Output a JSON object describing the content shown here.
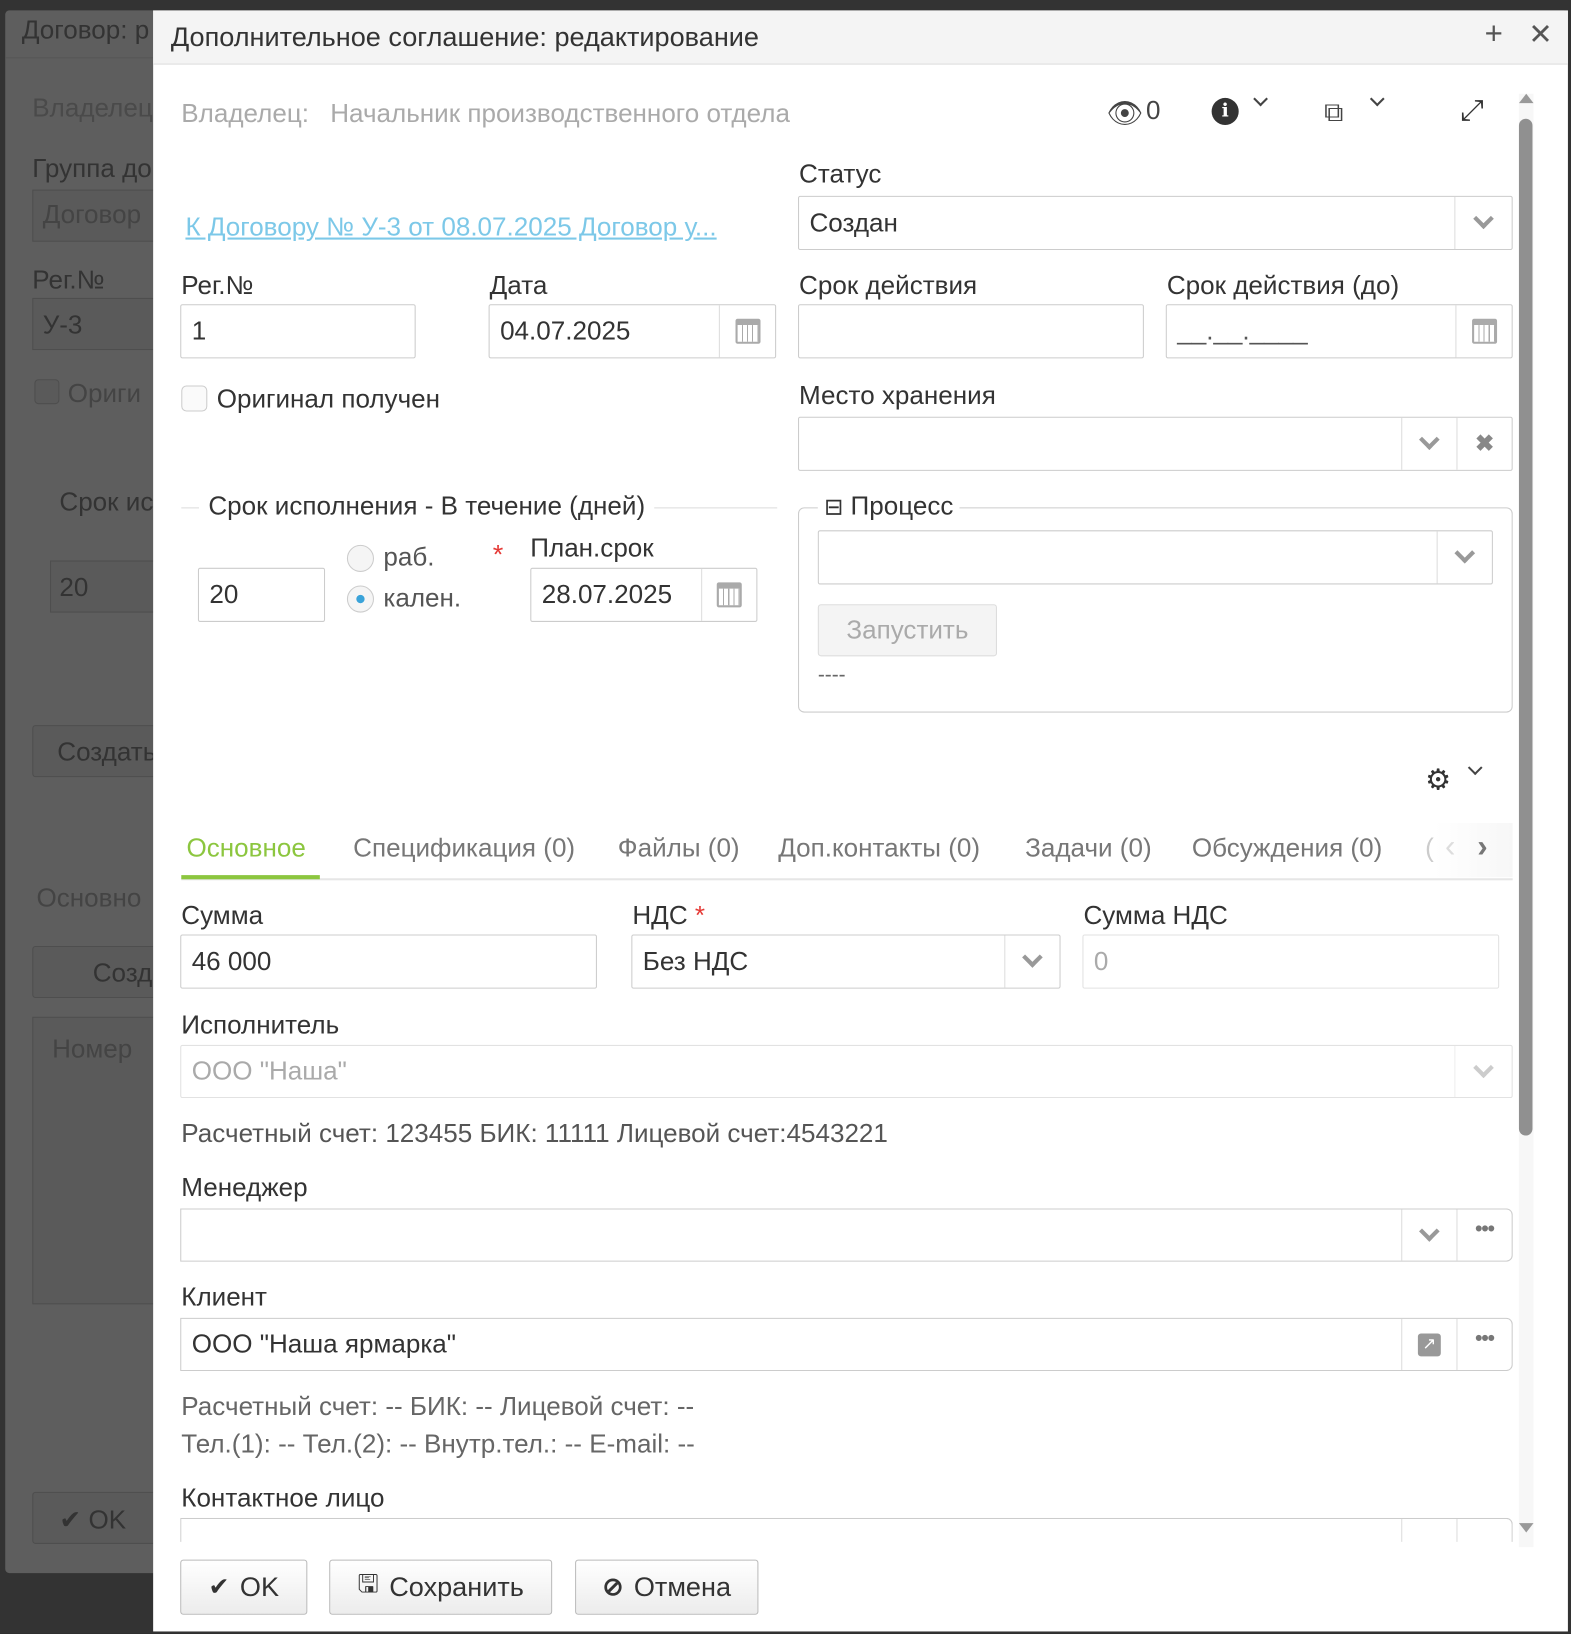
{
  "background": {
    "title": "Договор: р",
    "owner": "Владелец",
    "group_label": "Группа до",
    "group_value": "Договор",
    "reg_label": "Рег.№",
    "reg_value": "У-3",
    "original": "Ориги",
    "term": "Срок ис",
    "days": "20",
    "create": "Создать",
    "tab": "Основно",
    "create_doc": "Созд",
    "number_col": "Номер",
    "ok": "OK"
  },
  "modal": {
    "title": "Дополнительное соглашение: редактирование",
    "owner_label": "Владелец:",
    "owner_value": "Начальник производственного отдела",
    "views_count": "0",
    "link": "К Договору № У-3 от 08.07.2025 Договор у...",
    "status_label": "Статус",
    "status_value": "Создан",
    "reg_label": "Рег.№",
    "reg_value": "1",
    "date_label": "Дата",
    "date_value": "04.07.2025",
    "validity_label": "Срок действия",
    "validity_value": "",
    "validity_to_label": "Срок действия (до)",
    "validity_to_placeholder": "__.__.____",
    "original_label": "Оригинал получен",
    "original_checked": false,
    "storage_label": "Место хранения",
    "storage_value": "",
    "execution": {
      "legend": "Срок исполнения - В течение (дней)",
      "days": "20",
      "radio_work": "раб.",
      "radio_cal": "кален.",
      "selected": "кален.",
      "plan_label": "План.срок",
      "plan_value": "28.07.2025"
    },
    "process": {
      "legend": "Процесс",
      "value": "",
      "run_button": "Запустить",
      "status": "----"
    },
    "tabs": [
      {
        "label": "Основное",
        "active": true
      },
      {
        "label": "Спецификация (0)"
      },
      {
        "label": "Файлы (0)"
      },
      {
        "label": "Доп.контакты (0)"
      },
      {
        "label": "Задачи (0)"
      },
      {
        "label": "Обсуждения (0)"
      },
      {
        "label": "("
      }
    ],
    "sum_label": "Сумма",
    "sum_value": "46 000",
    "vat_label": "НДС",
    "vat_value": "Без НДС",
    "vat_sum_label": "Сумма НДС",
    "vat_sum_value": "0",
    "executor_label": "Исполнитель",
    "executor_value": "ООО \"Наша\"",
    "executor_info": "Расчетный счет: 123455 БИК: 11111 Лицевой счет:4543221",
    "manager_label": "Менеджер",
    "manager_value": "",
    "client_label": "Клиент",
    "client_value": "ООО \"Наша ярмарка\"",
    "client_info_1": "Расчетный счет: -- БИК: -- Лицевой счет: --",
    "client_info_2": "Тел.(1): -- Тел.(2): -- Внутр.тел.: -- E-mail: --",
    "contact_label": "Контактное лицо",
    "ok_button": "OK",
    "save_button": "Сохранить",
    "cancel_button": "Отмена"
  },
  "colors": {
    "accent": "#8cc63f",
    "link": "#7cc8e8",
    "required": "#e53935"
  }
}
